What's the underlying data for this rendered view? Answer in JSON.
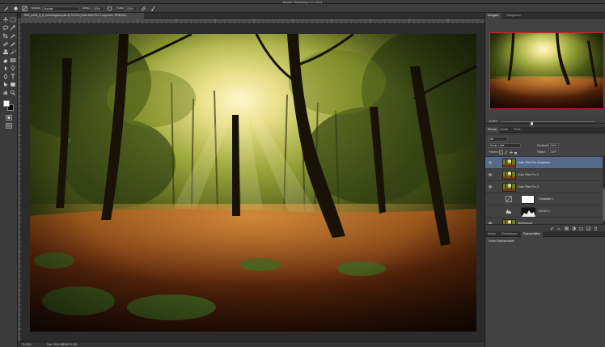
{
  "app": {
    "window_title": "Adobe Photoshop CC 2014"
  },
  "options_bar": {
    "modus_label": "Modus:",
    "modus_value": "Normal",
    "dekk_label": "Dekk.:",
    "dekk_value": "100%",
    "fluss_label": "Fluss:",
    "fluss_value": "100%"
  },
  "document": {
    "tab_title": "IMG_4451_4_5_tonemapped.psd @ 33,3% (Color Efex Pro 4 kopieren, RGB/16*)",
    "zoom": "33,33%",
    "doc_size": "Dok: 59,8 MB/562,5 MB"
  },
  "tools": [
    {
      "icon": "move-icon"
    },
    {
      "icon": "marquee-icon"
    },
    {
      "icon": "lasso-icon"
    },
    {
      "icon": "quick-select-icon"
    },
    {
      "icon": "crop-icon"
    },
    {
      "icon": "eyedropper-icon"
    },
    {
      "icon": "healing-brush-icon"
    },
    {
      "icon": "brush-icon"
    },
    {
      "icon": "clone-stamp-icon"
    },
    {
      "icon": "history-brush-icon"
    },
    {
      "icon": "eraser-icon"
    },
    {
      "icon": "gradient-icon"
    },
    {
      "icon": "blur-icon"
    },
    {
      "icon": "dodge-icon"
    },
    {
      "icon": "pen-icon"
    },
    {
      "icon": "type-icon"
    },
    {
      "icon": "path-select-icon"
    },
    {
      "icon": "shape-icon"
    },
    {
      "icon": "hand-icon"
    },
    {
      "icon": "zoom-icon"
    }
  ],
  "navigator": {
    "tabs": [
      "Navigator",
      "Histogramm"
    ],
    "zoom": "33,33%",
    "zoom_fraction": 0.33
  },
  "layers_panel": {
    "tabs": [
      "Ebenen",
      "Kanäle",
      "Pfade"
    ],
    "filter_label": "Art",
    "blend_mode": "Deckr. Licht",
    "opacity_label": "Deckkraft:",
    "opacity": "100%",
    "lock_label": "Fixieren:",
    "fill_label": "Fläche:",
    "fill": "100%",
    "layers": [
      {
        "name": "Color Efex Pro 4 kopieren",
        "selected": true,
        "visible": true,
        "kind": "photo"
      },
      {
        "name": "Color Efex Pro 4",
        "selected": false,
        "visible": true,
        "kind": "photo"
      },
      {
        "name": "Color Efex Pro 4",
        "selected": false,
        "visible": true,
        "kind": "photo"
      },
      {
        "name": "Gradation 1",
        "selected": false,
        "visible": false,
        "kind": "curves"
      },
      {
        "name": "Kurven 1",
        "selected": false,
        "visible": false,
        "kind": "levels"
      },
      {
        "name": "Hintergrund",
        "selected": false,
        "visible": true,
        "kind": "photo"
      }
    ]
  },
  "properties_panel": {
    "tabs": [
      "Absatz",
      "Einstellungen",
      "Eigenschaften"
    ],
    "message": "Keine Eigenschaften"
  },
  "colors": {
    "selection": "#566a8c",
    "navigator_frame": "#e02020"
  }
}
